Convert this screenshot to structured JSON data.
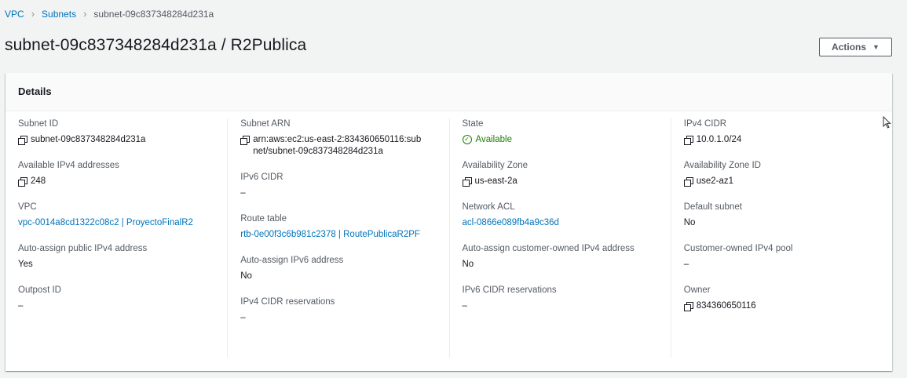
{
  "breadcrumb": {
    "items": [
      "VPC",
      "Subnets",
      "subnet-09c837348284d231a"
    ],
    "separator": "›"
  },
  "page": {
    "title": "subnet-09c837348284d231a / R2Publica",
    "actions_label": "Actions",
    "actions_caret": "▼"
  },
  "details": {
    "header": "Details",
    "columns": [
      [
        {
          "label": "Subnet ID",
          "value": "subnet-09c837348284d231a",
          "copy": true
        },
        {
          "label": "Available IPv4 addresses",
          "value": "248",
          "copy": true
        },
        {
          "label": "VPC",
          "value": "vpc-0014a8cd1322c08c2 | ProyectoFinalR2",
          "link": true
        },
        {
          "label": "Auto-assign public IPv4 address",
          "value": "Yes"
        },
        {
          "label": "Outpost ID",
          "value": "–"
        }
      ],
      [
        {
          "label": "Subnet ARN",
          "value": "arn:aws:ec2:us-east-2:834360650116:subnet/subnet-09c837348284d231a",
          "copy": true
        },
        {
          "label": "IPv6 CIDR",
          "value": "–"
        },
        {
          "label": "Route table",
          "value": "rtb-0e00f3c6b981c2378 | RoutePublicaR2PF",
          "link": true
        },
        {
          "label": "Auto-assign IPv6 address",
          "value": "No"
        },
        {
          "label": "IPv4 CIDR reservations",
          "value": "–"
        }
      ],
      [
        {
          "label": "State",
          "value": "Available",
          "status": "available"
        },
        {
          "label": "Availability Zone",
          "value": "us-east-2a",
          "copy": true
        },
        {
          "label": "Network ACL",
          "value": "acl-0866e089fb4a9c36d",
          "link": true
        },
        {
          "label": "Auto-assign customer-owned IPv4 address",
          "value": "No"
        },
        {
          "label": "IPv6 CIDR reservations",
          "value": "–"
        }
      ],
      [
        {
          "label": "IPv4 CIDR",
          "value": "10.0.1.0/24",
          "copy": true
        },
        {
          "label": "Availability Zone ID",
          "value": "use2-az1",
          "copy": true
        },
        {
          "label": "Default subnet",
          "value": "No"
        },
        {
          "label": "Customer-owned IPv4 pool",
          "value": "–"
        },
        {
          "label": "Owner",
          "value": "834360650116",
          "copy": true
        }
      ]
    ]
  },
  "colors": {
    "link": "#0073bb",
    "status_available": "#1d8102",
    "text": "#16191f",
    "label": "#545b64"
  }
}
